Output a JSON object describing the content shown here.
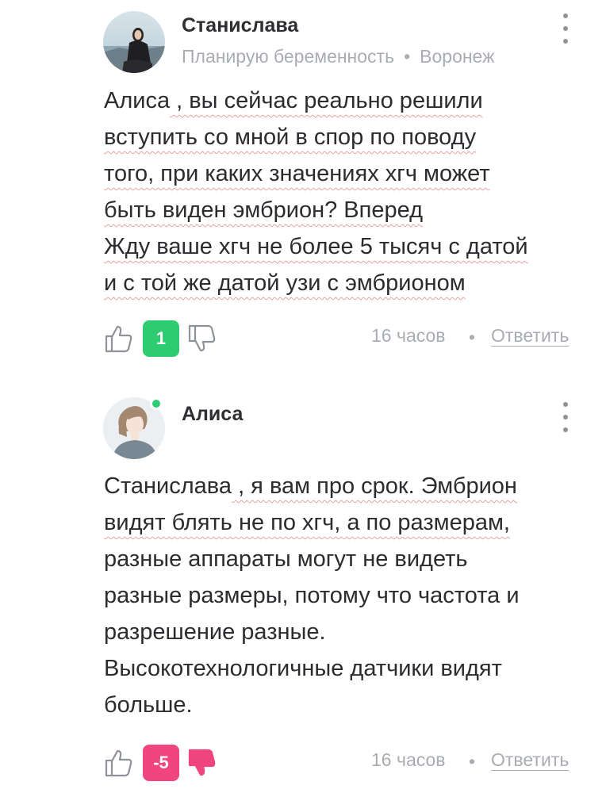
{
  "colors": {
    "upvote_score_bg": "#2ecc71",
    "downvote_score_bg": "#f0457f",
    "online": "#2ecc71",
    "muted_text": "#a9adb3"
  },
  "comments": [
    {
      "author": "Станислава",
      "status": "Планирую беременность",
      "city": "Воронеж",
      "online": false,
      "lines": [
        [
          "Алиса",
          " , вы сейчас реально решили"
        ],
        [
          "вступить со мной в спор по поводу"
        ],
        [
          "того, при каких значениях хгч может"
        ],
        [
          "быть виден эмбрион? Вперед"
        ],
        [
          "Жду ваше хгч не более 5 тысяч с датой"
        ],
        [
          "и с той же датой узи с эмбрионом"
        ]
      ],
      "score": "1",
      "score_color": "#2ecc71",
      "time": "16 часов",
      "separator": "•",
      "reply_label": "Ответить",
      "like_icon": "thumbs-up-icon",
      "dislike_icon": "thumbs-down-icon"
    },
    {
      "author": "Алиса",
      "status": "",
      "city": "",
      "online": true,
      "lines": [
        [
          "Станислава",
          " , я вам про срок. Эмбрион"
        ],
        [
          "видят блять не по хгч, а по размерам,"
        ],
        [
          "разные аппараты могут не видеть"
        ],
        [
          "разные размеры, потому что частота и"
        ],
        [
          "разрешение разные."
        ],
        [
          "Высокотехнологичные датчики видят"
        ],
        [
          "больше."
        ]
      ],
      "score": "-5",
      "score_color": "#f0457f",
      "time": "16 часов",
      "separator": "•",
      "reply_label": "Ответить",
      "like_icon": "thumbs-up-icon",
      "dislike_icon": "thumbs-down-icon"
    }
  ]
}
